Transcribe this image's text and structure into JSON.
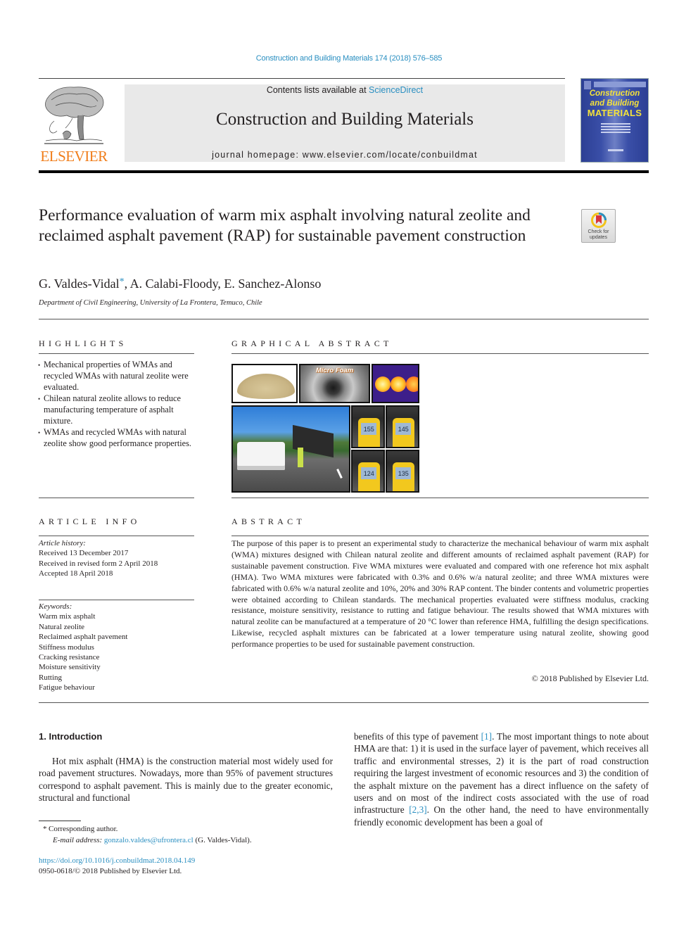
{
  "header": {
    "journal_ref": "Construction and Building Materials 174 (2018) 576–585",
    "contents_prefix": "Contents lists available at ",
    "contents_link": "ScienceDirect",
    "journal_title": "Construction and Building Materials",
    "homepage": "journal homepage: www.elsevier.com/locate/conbuildmat",
    "publisher_logo_text": "ELSEVIER",
    "cover": {
      "line1": "Construction",
      "line2": "and Building",
      "line3": "MATERIALS"
    },
    "colors": {
      "link": "#2a8fc1",
      "elsevier_orange": "#f07d1a",
      "cover_blue": "#2c3f94",
      "cover_title_yellow": "#f5e33a"
    }
  },
  "article": {
    "title": "Performance evaluation of warm mix asphalt involving natural zeolite and reclaimed asphalt pavement (RAP) for sustainable pavement construction",
    "check_updates_label": "Check for updates",
    "authors": {
      "first": "G. Valdes-Vidal",
      "corresponding_mark": "*",
      "rest": ", A. Calabi-Floody, E. Sanchez-Alonso"
    },
    "affiliation": "Department of Civil Engineering, University of La Frontera, Temuco, Chile"
  },
  "highlights": {
    "label": "HIGHLIGHTS",
    "items": [
      "Mechanical properties of WMAs and recycled WMAs with natural zeolite were evaluated.",
      "Chilean natural zeolite allows to reduce manufacturing temperature of asphalt mixture.",
      "WMAs and recycled WMAs with natural zeolite show good performance properties."
    ]
  },
  "graphical_abstract": {
    "label": "GRAPHICAL ABSTRACT",
    "images": [
      {
        "name": "natural-zeolite-powder"
      },
      {
        "name": "micro-foam",
        "caption": "Micro Foam"
      },
      {
        "name": "thermal-camera"
      },
      {
        "name": "road-paving-site"
      },
      {
        "name": "thermometer-reading-1",
        "reading": "155"
      },
      {
        "name": "thermometer-reading-2",
        "reading": "145"
      },
      {
        "name": "thermometer-reading-3",
        "reading": "124"
      },
      {
        "name": "thermometer-reading-4",
        "reading": "135"
      }
    ]
  },
  "article_info": {
    "label": "ARTICLE INFO",
    "history_label": "Article history:",
    "history": [
      "Received 13 December 2017",
      "Received in revised form 2 April 2018",
      "Accepted 18 April 2018"
    ],
    "keywords_label": "Keywords:",
    "keywords": [
      "Warm mix asphalt",
      "Natural zeolite",
      "Reclaimed asphalt pavement",
      "Stiffness modulus",
      "Cracking resistance",
      "Moisture sensitivity",
      "Rutting",
      "Fatigue behaviour"
    ]
  },
  "abstract": {
    "label": "ABSTRACT",
    "text": "The purpose of this paper is to present an experimental study to characterize the mechanical behaviour of warm mix asphalt (WMA) mixtures designed with Chilean natural zeolite and different amounts of reclaimed asphalt pavement (RAP) for sustainable pavement construction. Five WMA mixtures were evaluated and compared with one reference hot mix asphalt (HMA). Two WMA mixtures were fabricated with 0.3% and 0.6% w/a natural zeolite; and three WMA mixtures were fabricated with 0.6% w/a natural zeolite and 10%, 20% and 30% RAP content. The binder contents and volumetric properties were obtained according to Chilean standards. The mechanical properties evaluated were stiffness modulus, cracking resistance, moisture sensitivity, resistance to rutting and fatigue behaviour. The results showed that WMA mixtures with natural zeolite can be manufactured at a temperature of 20 °C lower than reference HMA, fulfilling the design specifications. Likewise, recycled asphalt mixtures can be fabricated at a lower temperature using natural zeolite, showing good performance properties to be used for sustainable pavement construction.",
    "copyright": "© 2018 Published by Elsevier Ltd."
  },
  "body": {
    "section_heading": "1. Introduction",
    "left_paragraph": "Hot mix asphalt (HMA) is the construction material most widely used for road pavement structures. Nowadays, more than 95% of pavement structures correspond to asphalt pavement. This is mainly due to the greater economic, structural and functional",
    "right_paragraph": {
      "part1": "benefits of this type of pavement ",
      "ref1": "[1]",
      "part2": ". The most important things to note about HMA are that: 1) it is used in the surface layer of pavement, which receives all traffic and environmental stresses, 2) it is the part of road construction requiring the largest investment of economic resources and 3) the condition of the asphalt mixture on the pavement has a direct influence on the safety of users and on most of the indirect costs associated with the use of road infrastructure ",
      "ref2": "[2,3]",
      "part3": ". On the other hand, the need to have environmentally friendly economic development has been a goal of"
    }
  },
  "footnote": {
    "star": "*",
    "corresponding": "Corresponding author.",
    "email_label": "E-mail address: ",
    "email": "gonzalo.valdes@ufrontera.cl",
    "email_suffix": " (G. Valdes-Vidal).",
    "doi": "https://doi.org/10.1016/j.conbuildmat.2018.04.149",
    "issn_line": "0950-0618/© 2018 Published by Elsevier Ltd."
  }
}
